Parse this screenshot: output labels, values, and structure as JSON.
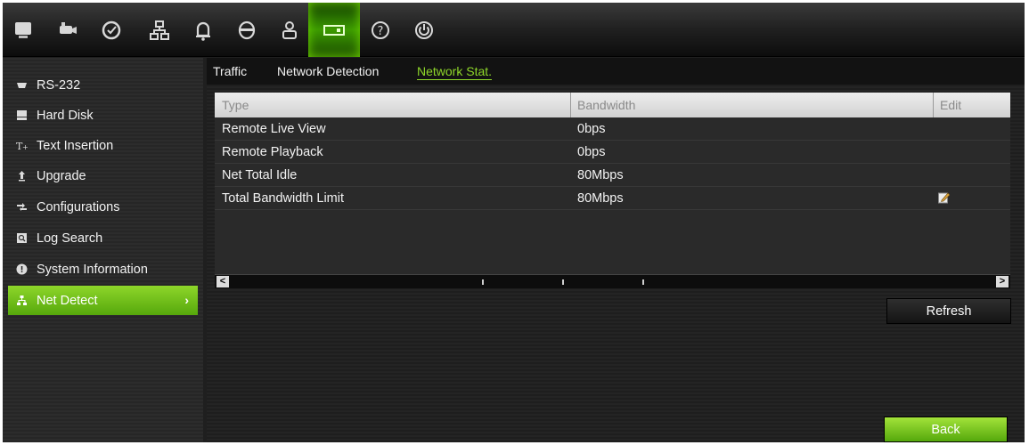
{
  "toolbar": {
    "icons": [
      "monitor-icon",
      "camera-icon",
      "clock-icon",
      "network-icon",
      "bell-icon",
      "recording-icon",
      "user-icon",
      "storage-icon",
      "help-icon",
      "power-icon"
    ],
    "active_icon": "storage-icon",
    "accent": "#6fd400"
  },
  "sidebar": {
    "items": [
      {
        "label": "RS-232",
        "icon": "rs232-icon"
      },
      {
        "label": "Hard Disk",
        "icon": "hard-disk-icon"
      },
      {
        "label": "Text Insertion",
        "icon": "text-insertion-icon"
      },
      {
        "label": "Upgrade",
        "icon": "upgrade-icon"
      },
      {
        "label": "Configurations",
        "icon": "configurations-icon"
      },
      {
        "label": "Log Search",
        "icon": "log-search-icon"
      },
      {
        "label": "System Information",
        "icon": "info-icon"
      },
      {
        "label": "Net Detect",
        "icon": "net-detect-icon",
        "active": true
      }
    ],
    "active_color": "#8ed62a"
  },
  "tabs": [
    {
      "label": "Traffic"
    },
    {
      "label": "Network Detection"
    },
    {
      "label": "Network Stat.",
      "active": true
    }
  ],
  "table": {
    "columns": [
      "Type",
      "Bandwidth",
      "Edit"
    ],
    "rows": [
      {
        "type": "Remote Live View",
        "bandwidth": "0bps",
        "editable": false
      },
      {
        "type": "Remote Playback",
        "bandwidth": "0bps",
        "editable": false
      },
      {
        "type": "Net Total Idle",
        "bandwidth": "80Mbps",
        "editable": false
      },
      {
        "type": "Total Bandwidth Limit",
        "bandwidth": "80Mbps",
        "editable": true
      }
    ]
  },
  "buttons": {
    "refresh": "Refresh",
    "back": "Back"
  }
}
